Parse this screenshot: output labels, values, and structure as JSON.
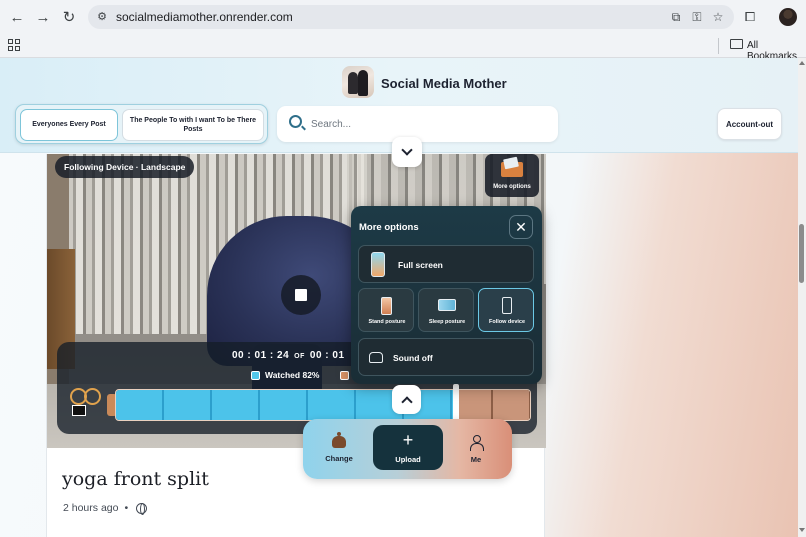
{
  "browser": {
    "url": "socialmediamother.onrender.com",
    "bookmarks_label": "All Bookmarks",
    "icons": [
      "back-arrow-icon",
      "forward-arrow-icon",
      "reload-icon",
      "site-settings-icon",
      "install-app-icon",
      "password-key-icon",
      "bookmark-star-icon",
      "extensions-icon",
      "profile-avatar"
    ]
  },
  "header": {
    "brand": "Social Media Mother",
    "tabs": [
      {
        "label": "Everyones Every Post",
        "active": true
      },
      {
        "label": "The People To with I want To be There Posts",
        "active": false
      }
    ],
    "search_placeholder": "Search...",
    "account_button": "Account-out"
  },
  "video": {
    "device_badge": "Following Device · Landscape",
    "more_options_label": "More options",
    "time_current": "00 : 01 : 24",
    "time_of": "OF",
    "time_total": "00 : 01",
    "watched_label": "Watched 82%",
    "watched_fraction": 0.82,
    "colors": {
      "watched": "#52c7ea",
      "remaining": "#d99265"
    }
  },
  "popover": {
    "title": "More options",
    "close_glyph": "✕",
    "full_screen": "Full screen",
    "tiles": [
      {
        "label": "Stand posture",
        "active": false
      },
      {
        "label": "Sleep posture",
        "active": false
      },
      {
        "label": "Follow device",
        "active": true
      }
    ],
    "sound": "Sound off"
  },
  "post": {
    "title": "yoga front split",
    "time": "2 hours ago",
    "separator": "•",
    "visibility_icon": "globe-icon"
  },
  "bottom_nav": {
    "change": "Change",
    "upload": "Upload",
    "me": "Me"
  }
}
